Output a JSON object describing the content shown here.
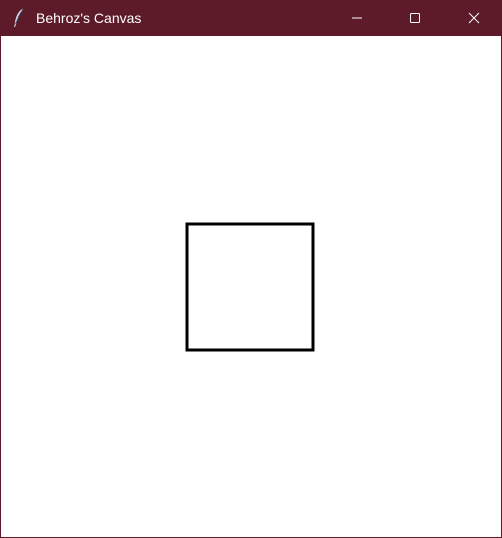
{
  "window": {
    "title": "Behroz's Canvas",
    "titlebar_color": "#5d1a28",
    "app_icon": "feather-icon"
  },
  "controls": {
    "minimize_icon": "minimize-icon",
    "maximize_icon": "maximize-icon",
    "close_icon": "close-icon"
  },
  "canvas": {
    "background": "#ffffff",
    "shapes": [
      {
        "type": "square",
        "stroke": "#000000",
        "fill": "none"
      }
    ]
  }
}
